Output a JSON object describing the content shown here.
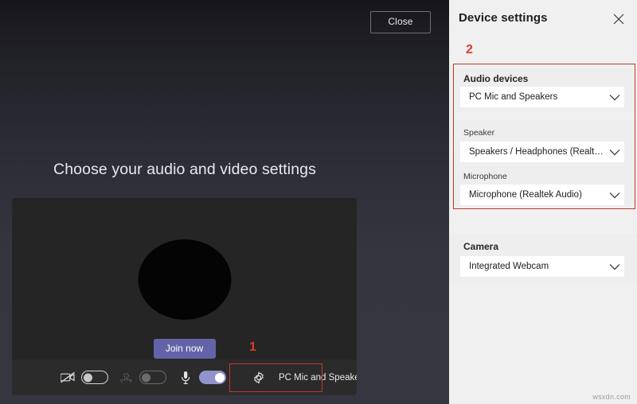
{
  "stage": {
    "close_label": "Close",
    "title": "Choose your audio and video settings",
    "join_label": "Join now",
    "device_chip_label": "PC Mic and Speakers",
    "annotation_1": "1",
    "icons": {
      "camera_off": "camera-off-icon",
      "background_blur": "background-blur-icon",
      "microphone": "microphone-icon",
      "gear": "gear-icon"
    },
    "toggles": {
      "camera_state": "off",
      "blur_state": "disabled",
      "mic_state": "on"
    }
  },
  "panel": {
    "title": "Device settings",
    "close_icon": "close-icon",
    "annotation_2": "2",
    "audio_devices": {
      "label": "Audio devices",
      "value": "PC Mic and Speakers"
    },
    "speaker": {
      "label": "Speaker",
      "value": "Speakers / Headphones (Realtek Aud..."
    },
    "microphone": {
      "label": "Microphone",
      "value": "Microphone (Realtek Audio)"
    },
    "camera": {
      "label": "Camera",
      "value": "Integrated Webcam"
    }
  },
  "watermark": "wsxdn.com",
  "colors": {
    "accent_purple": "#6264a7",
    "toggle_on": "#9293cc",
    "annotation_red": "#c0392b",
    "panel_bg": "#f0f0f0",
    "stage_bg": "#35353f"
  }
}
